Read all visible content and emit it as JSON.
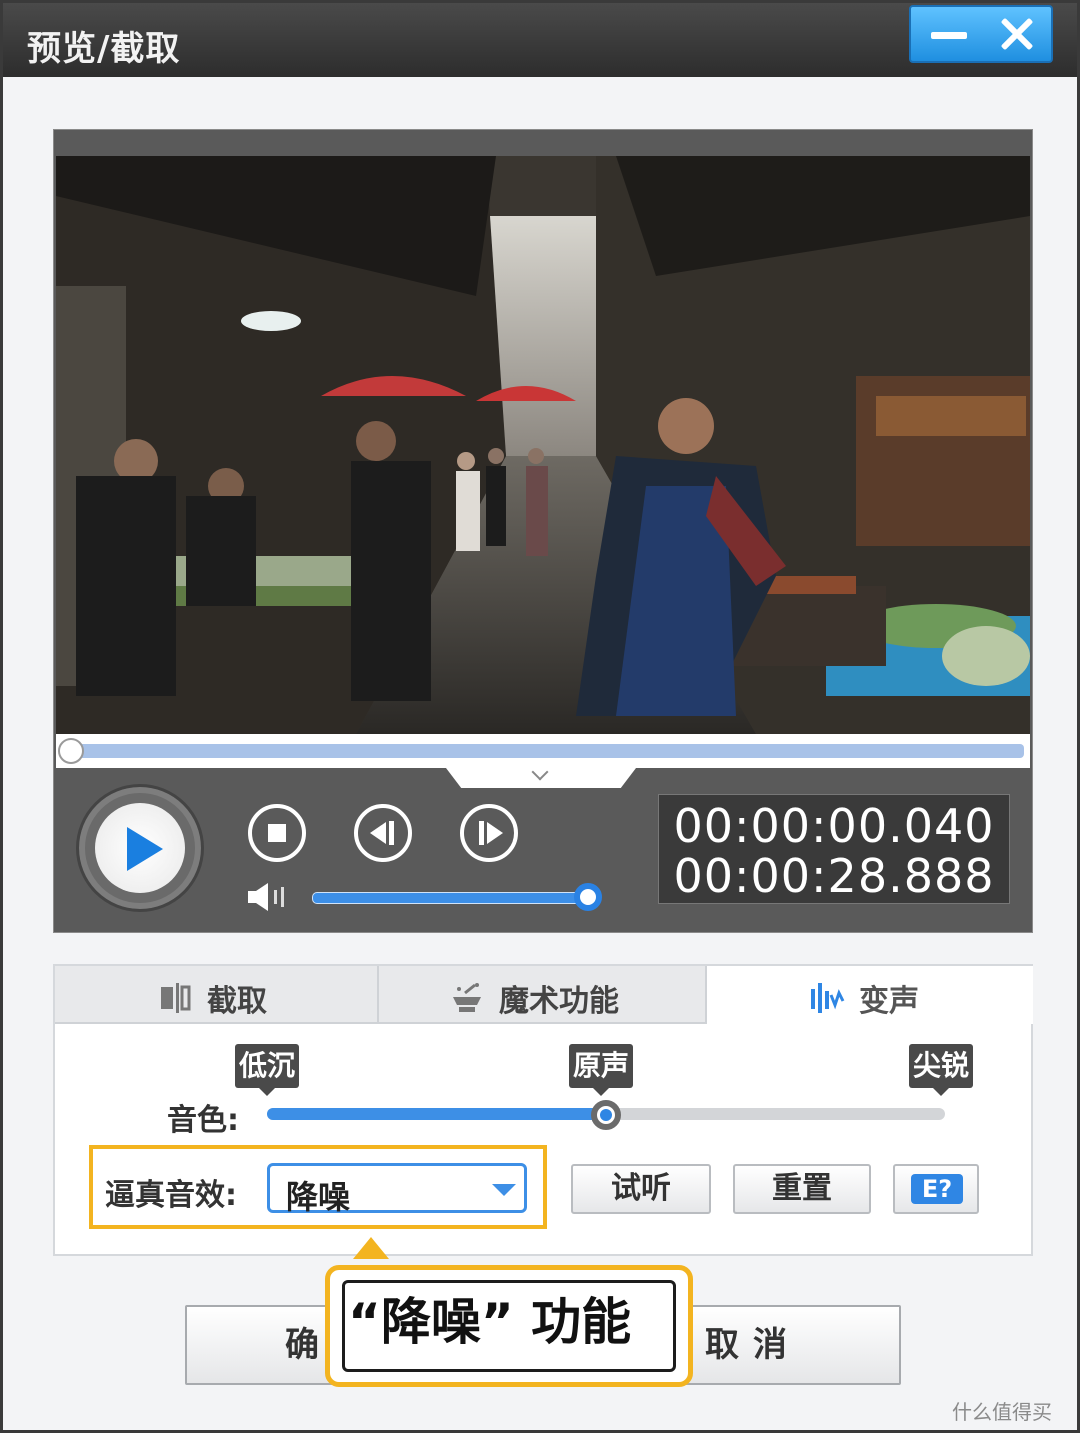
{
  "window": {
    "title": "预览/截取"
  },
  "player": {
    "current_time": "00:00:00.040",
    "total_time": "00:00:28.888",
    "playback_progress": 0.0014,
    "volume_level": 0.95
  },
  "tabs": [
    {
      "label": "截取",
      "icon": "capture-icon"
    },
    {
      "label": "魔术功能",
      "icon": "magic-icon"
    },
    {
      "label": "变声",
      "icon": "voice-wave-icon",
      "active": true
    }
  ],
  "voice": {
    "tone_caption": "音色:",
    "tone_marks": [
      "低沉",
      "原声",
      "尖锐"
    ],
    "tone_level": 0.5,
    "effect_caption": "逼真音效:",
    "effect_value": "降噪",
    "listen_label": "试听",
    "reset_label": "重置",
    "help_icon": "help-icon"
  },
  "dialog": {
    "ok_label": "确",
    "cancel_label": "取消"
  },
  "callout": {
    "text": "“降噪” 功能"
  },
  "watermark": "什么值得买",
  "colors": {
    "accent": "#3d8fe6",
    "highlight": "#f3b420",
    "titlebar": "#3a3a3a"
  }
}
